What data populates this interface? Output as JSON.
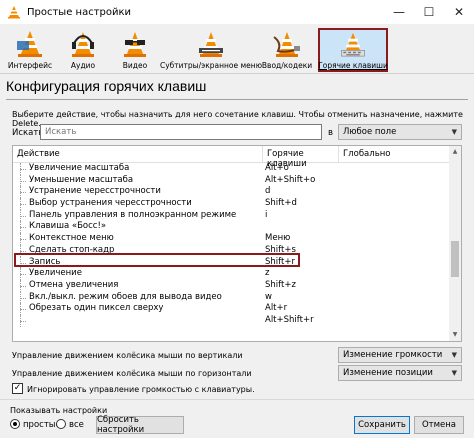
{
  "window": {
    "title": "Простые настройки",
    "minimize": "—",
    "maximize": "☐",
    "close": "✕"
  },
  "toolbar": [
    {
      "label": "Интерфейс",
      "icon": "cone-interface-icon",
      "active": false
    },
    {
      "label": "Аудио",
      "icon": "cone-headphones-icon",
      "active": false
    },
    {
      "label": "Видео",
      "icon": "cone-glasses-icon",
      "active": false
    },
    {
      "label": "Субтитры/экранное меню",
      "icon": "cone-subtitles-icon",
      "active": false
    },
    {
      "label": "Ввод/кодеки",
      "icon": "cone-cable-icon",
      "active": false
    },
    {
      "label": "Горячие клавиши",
      "icon": "cone-hotkeys-icon",
      "active": true
    }
  ],
  "heading": "Конфигурация горячих клавиш",
  "hint": "Выберите действие, чтобы назначить для него сочетание клавиш. Чтобы отменить назначение, нажмите Delete.",
  "search": {
    "label": "Искать",
    "placeholder": "Искать",
    "in_label": "в",
    "field": "Любое поле"
  },
  "table": {
    "columns": [
      "Действие",
      "Горячие клавиши",
      "Глобально"
    ],
    "rows": [
      {
        "action": "Увеличение масштаба",
        "hotkey": "Alt+o",
        "global": ""
      },
      {
        "action": "Уменьшение масштаба",
        "hotkey": "Alt+Shift+o",
        "global": ""
      },
      {
        "action": "Устранение чересстрочности",
        "hotkey": "d",
        "global": ""
      },
      {
        "action": "Выбор устранения чересстрочности",
        "hotkey": "Shift+d",
        "global": ""
      },
      {
        "action": "Панель управления в полноэкранном режиме",
        "hotkey": "i",
        "global": ""
      },
      {
        "action": "Клавиша «Босс!»",
        "hotkey": "",
        "global": ""
      },
      {
        "action": "Контекстное меню",
        "hotkey": "Меню",
        "global": ""
      },
      {
        "action": "Сделать стоп-кадр",
        "hotkey": "Shift+s",
        "global": ""
      },
      {
        "action": "Запись",
        "hotkey": "Shift+r",
        "global": ""
      },
      {
        "action": "Увеличение",
        "hotkey": "z",
        "global": ""
      },
      {
        "action": "Отмена увеличения",
        "hotkey": "Shift+z",
        "global": ""
      },
      {
        "action": "Вкл./выкл. режим обоев для вывода видео",
        "hotkey": "w",
        "global": ""
      },
      {
        "action": "Обрезать один пиксел сверху",
        "hotkey": "Alt+r",
        "global": ""
      },
      {
        "action": "",
        "hotkey": "Alt+Shift+r",
        "global": ""
      }
    ],
    "highlighted_row": "Сделать стоп-кадр"
  },
  "wheel": {
    "vertical_label": "Управление движением колёсика мыши по вертикали",
    "vertical_value": "Изменение громкости",
    "horizontal_label": "Управление движением колёсика мыши по горизонтали",
    "horizontal_value": "Изменение позиции"
  },
  "ignore_volume": {
    "label": "Игнорировать управление громкостью с клавиатуры.",
    "checked": true,
    "mark": "✓"
  },
  "show_settings": {
    "label": "Показывать настройки",
    "simple": "простые",
    "all": "все",
    "selected": "простые"
  },
  "buttons": {
    "reset": "Сбросить настройки",
    "save": "Сохранить",
    "cancel": "Отмена"
  }
}
